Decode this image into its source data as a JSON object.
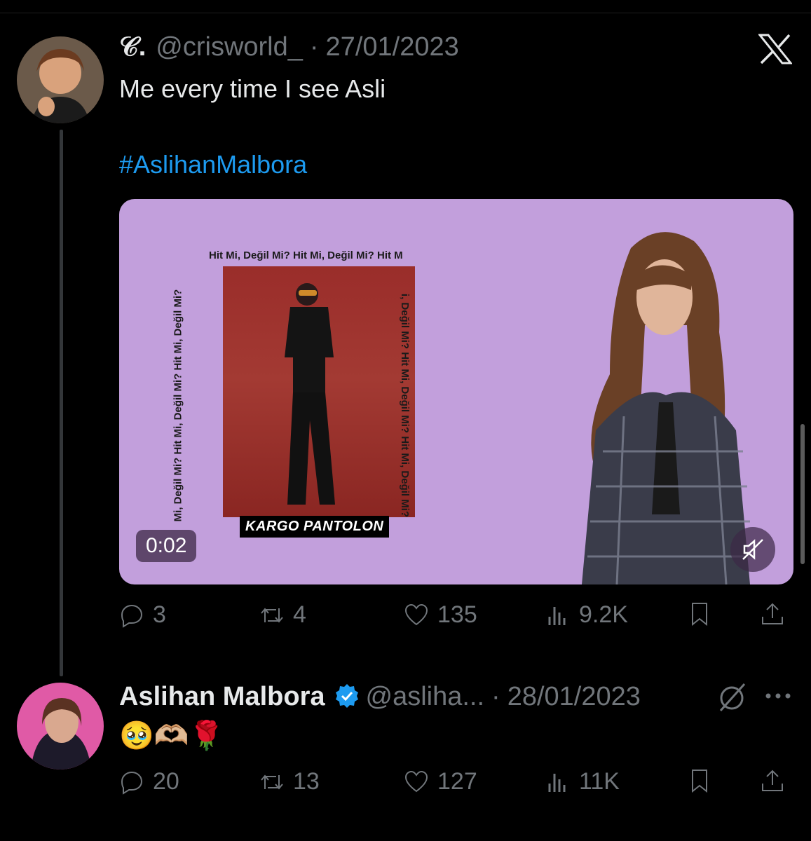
{
  "tweet1": {
    "display_name": "𝒞.",
    "handle": "@crisworld_",
    "separator": "·",
    "date": "27/01/2023",
    "text": "Me every time I see Asli",
    "hashtag": "#AslihanMalbora",
    "media": {
      "frame_text_top": "Hit Mi, Değil Mi? Hit Mi, Değil Mi? Hit M",
      "frame_text_left": "Mi, Değil Mi? Hit Mi, Değil Mi? Hit Mi, Değil Mi?",
      "frame_text_right": "i, Değil Mi? Hit Mi, Değil Mi? Hit Mi, Değil Mi?",
      "caption": "KARGO PANTOLON",
      "timestamp": "0:02"
    },
    "actions": {
      "replies": "3",
      "retweets": "4",
      "likes": "135",
      "views": "9.2K"
    }
  },
  "tweet2": {
    "display_name": "Aslihan Malbora",
    "handle": "@asliha...",
    "separator": "·",
    "date": "28/01/2023",
    "text": "🥹🫶🏼🌹",
    "actions": {
      "replies": "20",
      "retweets": "13",
      "likes": "127",
      "views": "11K"
    }
  },
  "colors": {
    "background": "#000000",
    "text": "#e7e9ea",
    "muted": "#71767b",
    "link": "#1d9bf0",
    "verified": "#1d9bf0",
    "media_bg": "#c29fdc"
  }
}
